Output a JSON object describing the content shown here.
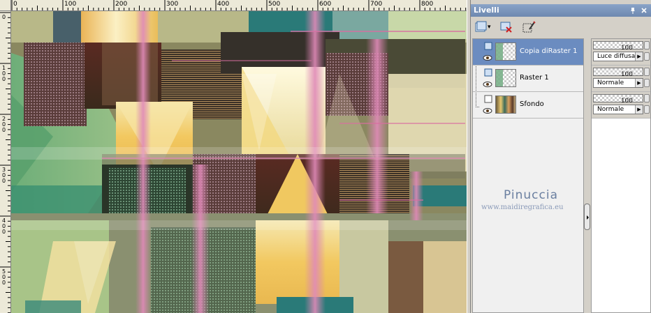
{
  "ruler": {
    "top_labels": [
      "0",
      "100",
      "200",
      "300",
      "400",
      "500",
      "600",
      "700",
      "800"
    ],
    "left_labels": [
      [
        "0"
      ],
      [
        "1",
        "0",
        "0"
      ],
      [
        "2",
        "0",
        "0"
      ],
      [
        "3",
        "0",
        "0"
      ],
      [
        "4",
        "0",
        "0"
      ],
      [
        "5",
        "0",
        "0"
      ]
    ]
  },
  "panel": {
    "title": "Livelli",
    "pin_icon": "pin-icon",
    "close_icon": "close-icon"
  },
  "toolbar": {
    "new_layer_icon": "new-raster-layer-icon",
    "dropdown_arrow": "▾",
    "delete_layer_icon": "delete-layer-icon",
    "edit_selection_icon": "edit-selection-icon"
  },
  "layers": [
    {
      "name": "Copia diRaster 1",
      "selected": true,
      "opacity": "100",
      "blend": "Luce diffusa",
      "thumb": "raster"
    },
    {
      "name": "Raster 1",
      "selected": false,
      "opacity": "100",
      "blend": "Normale",
      "thumb": "raster"
    },
    {
      "name": "Sfondo",
      "selected": false,
      "opacity": "100",
      "blend": "Normale",
      "thumb": "background"
    }
  ],
  "watermark": {
    "title": "Pinuccia",
    "url": "www.maidiregrafica.eu"
  },
  "colors": {
    "selected_row": "#6b8cc0",
    "titlebar": "#7a96be"
  }
}
